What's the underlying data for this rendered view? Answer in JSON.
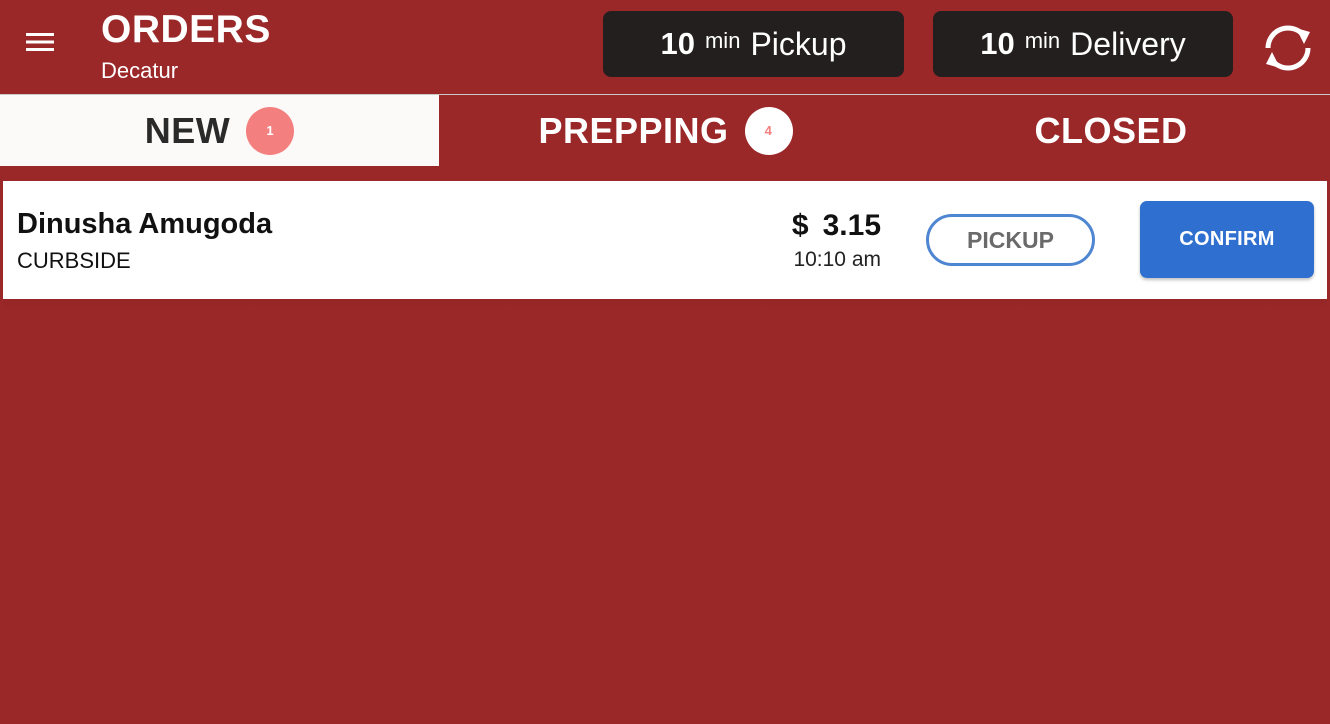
{
  "header": {
    "title": "ORDERS",
    "location": "Decatur",
    "pickup_time": {
      "value": "10",
      "unit": "min",
      "label": "Pickup"
    },
    "delivery_time": {
      "value": "10",
      "unit": "min",
      "label": "Delivery"
    }
  },
  "tabs": [
    {
      "label": "NEW",
      "count": "1",
      "active": true
    },
    {
      "label": "PREPPING",
      "count": "4",
      "active": false
    },
    {
      "label": "CLOSED",
      "active": false
    }
  ],
  "orders": [
    {
      "customer": "Dinusha Amugoda",
      "type": "CURBSIDE",
      "currency": "$",
      "amount": "3.15",
      "time": "10:10 am",
      "fulfillment_label": "PICKUP",
      "action_label": "CONFIRM"
    }
  ],
  "colors": {
    "brand_red": "#9b2829",
    "dark_pill": "#231f1f",
    "badge_pink": "#f47f7f",
    "confirm_blue": "#2f6fcf",
    "pickup_outline": "#4f86d2"
  },
  "icons": {
    "menu": "hamburger-menu-icon",
    "refresh": "refresh-icon"
  }
}
